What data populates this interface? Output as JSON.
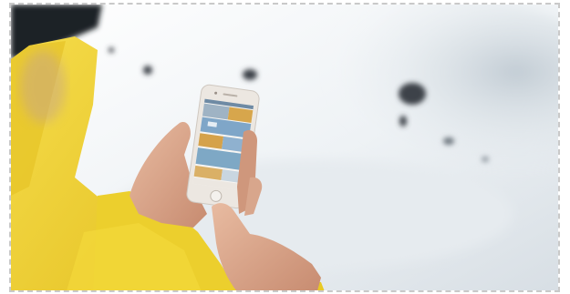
{
  "scene": {
    "description_tokens": [],
    "colors": {
      "snow_light": "#f3f6f8",
      "snow_shadow": "#c7cfd6",
      "jacket": "#f2d233",
      "jacket_dark": "#d4ae1a",
      "skin": "#d9a88f",
      "phone_body": "#e9e4df",
      "app_accent": "#d9a74d"
    },
    "icons": [
      "photo-frame",
      "smartphone-icon"
    ]
  }
}
